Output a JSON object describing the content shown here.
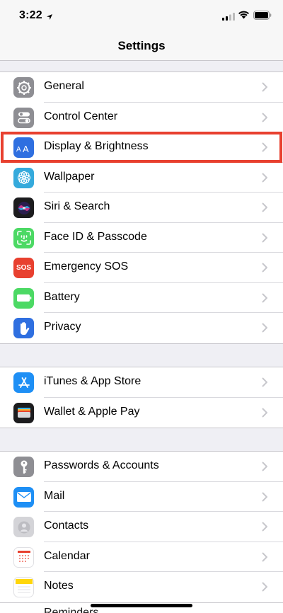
{
  "status_bar": {
    "time": "3:22",
    "icons": [
      "location-arrow-icon",
      "cellular-signal-icon",
      "wifi-icon",
      "battery-icon"
    ]
  },
  "nav": {
    "title": "Settings"
  },
  "groups": [
    {
      "items": [
        {
          "label": "General",
          "icon": "gear-icon",
          "color": "#8e8e93"
        },
        {
          "label": "Control Center",
          "icon": "toggles-icon",
          "color": "#8e8e93"
        },
        {
          "label": "Display & Brightness",
          "icon": "text-size-icon",
          "color": "#2f6fe0",
          "highlighted": true
        },
        {
          "label": "Wallpaper",
          "icon": "flower-icon",
          "color": "#35aadc"
        },
        {
          "label": "Siri & Search",
          "icon": "siri-icon",
          "color": "#1c1c1e"
        },
        {
          "label": "Face ID & Passcode",
          "icon": "face-id-icon",
          "color": "#4cd964"
        },
        {
          "label": "Emergency SOS",
          "icon": "sos-icon",
          "color": "#e8402f",
          "icon_text": "SOS"
        },
        {
          "label": "Battery",
          "icon": "battery-icon",
          "color": "#4cd964"
        },
        {
          "label": "Privacy",
          "icon": "hand-icon",
          "color": "#2f6fe0"
        }
      ]
    },
    {
      "items": [
        {
          "label": "iTunes & App Store",
          "icon": "app-store-icon",
          "color": "#1e8ff5"
        },
        {
          "label": "Wallet & Apple Pay",
          "icon": "wallet-icon",
          "color": "#1c1c1e"
        }
      ]
    },
    {
      "items": [
        {
          "label": "Passwords & Accounts",
          "icon": "key-icon",
          "color": "#8e8e93"
        },
        {
          "label": "Mail",
          "icon": "mail-icon",
          "color": "#1e8ff5"
        },
        {
          "label": "Contacts",
          "icon": "contacts-icon",
          "color": "#c7c7cc"
        },
        {
          "label": "Calendar",
          "icon": "calendar-icon",
          "color": "#ffffff"
        },
        {
          "label": "Notes",
          "icon": "notes-icon",
          "color": "#ffd60a"
        }
      ]
    }
  ],
  "partial_row_label": "Reminders"
}
